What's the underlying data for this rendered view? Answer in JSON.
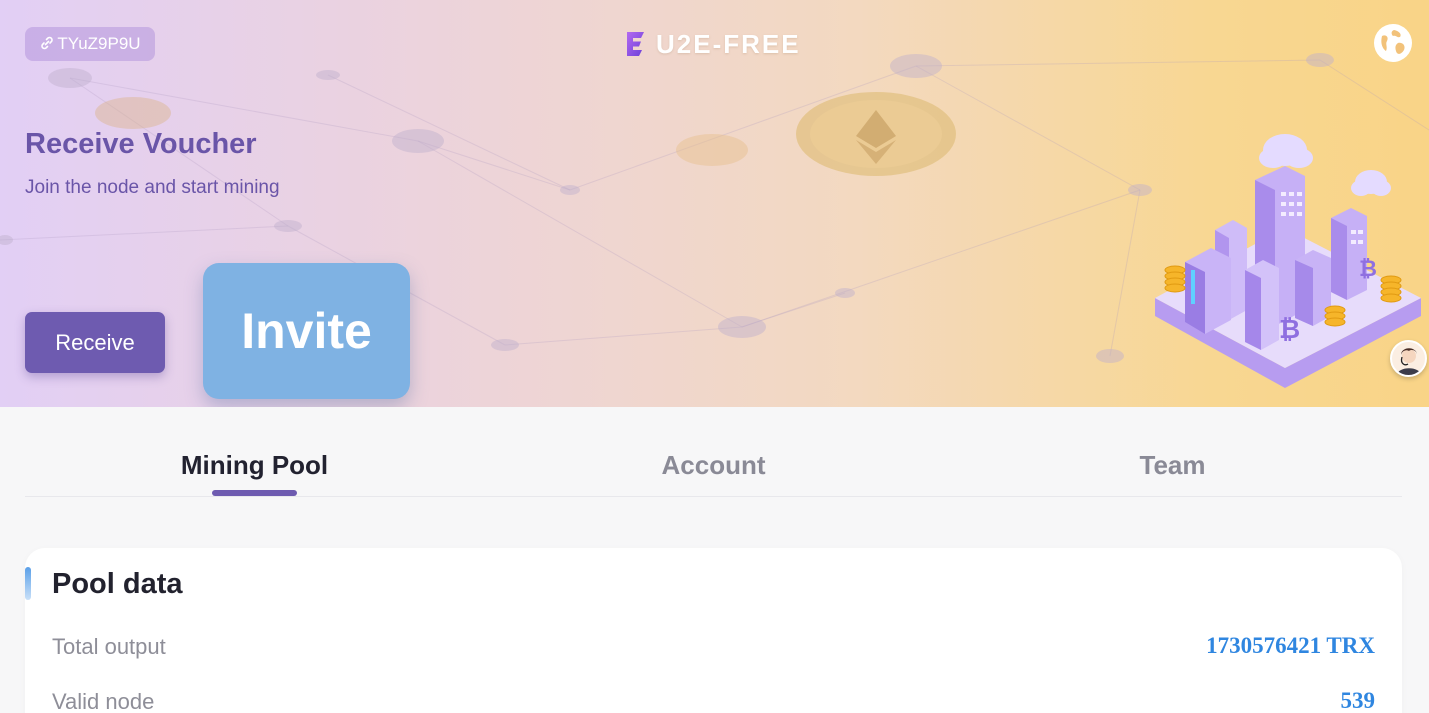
{
  "header": {
    "ref_code": "TYuZ9P9U",
    "logo_text": "U2E-FREE",
    "icons": {
      "link": "link-icon",
      "globe": "globe-icon",
      "support": "customer-support-avatar"
    }
  },
  "hero": {
    "title": "Receive Voucher",
    "subtitle": "Join the node and start mining",
    "receive_label": "Receive",
    "invite_label": "Invite"
  },
  "tabs": [
    {
      "label": "Mining Pool",
      "active": true
    },
    {
      "label": "Account",
      "active": false
    },
    {
      "label": "Team",
      "active": false
    }
  ],
  "pool": {
    "title": "Pool data",
    "rows": [
      {
        "label": "Total output",
        "value": "1730576421 TRX"
      },
      {
        "label": "Valid node",
        "value": "539"
      }
    ]
  },
  "colors": {
    "accent": "#6e5bb0",
    "invite": "#7fb2e3",
    "value": "#2f86e0",
    "banner_left": "#e2cff5",
    "banner_right": "#f9d487"
  }
}
